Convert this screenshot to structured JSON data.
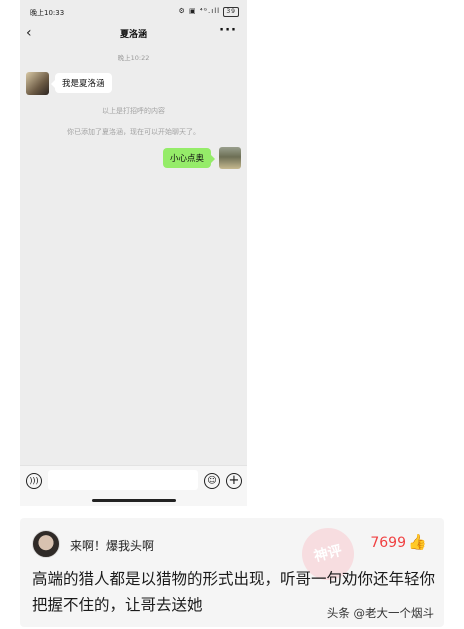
{
  "status_bar": {
    "time": "晚上10:33",
    "icons": "⚙ ▣ ⁴ᴳ.ıll",
    "battery": "39"
  },
  "chat": {
    "title": "夏洛涵",
    "back_icon": "chevron-left-icon",
    "more_icon": "ellipsis-icon",
    "timestamp": "晚上10:22",
    "messages": [
      {
        "side": "left",
        "text": "我是夏洛涵"
      },
      {
        "side": "right",
        "text": "小心点奥"
      }
    ],
    "system_messages": [
      "以上是打招呼的内容",
      "你已添加了夏洛涵，现在可以开始聊天了。"
    ],
    "input_icons": {
      "voice": "voice-icon",
      "emoji": "emoji-icon",
      "plus": "plus-icon"
    }
  },
  "comment": {
    "username": "来啊！爆我头啊",
    "likes": "7699",
    "stamp": "神评",
    "text": "高端的猎人都是以猎物的形式出现，听哥一句劝你还年轻你把握不住的，让哥去送她",
    "like_color": "#f04142"
  },
  "watermark": "头条 @老大一个烟斗"
}
